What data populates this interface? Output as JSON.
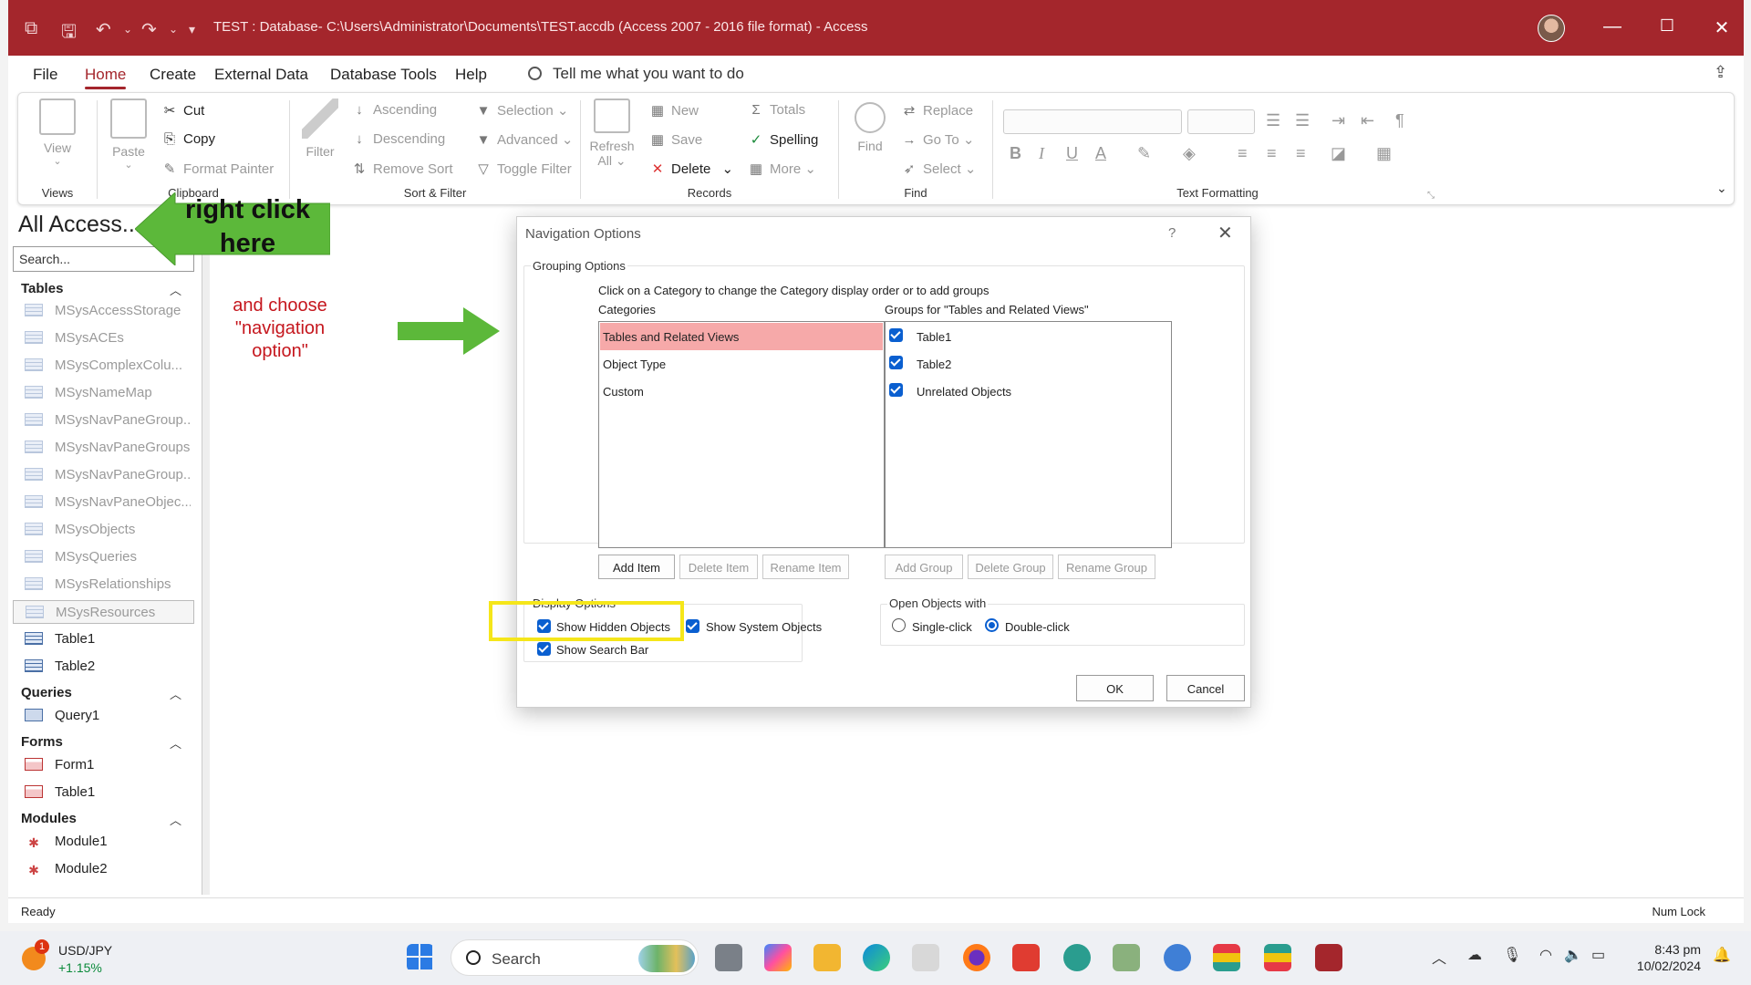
{
  "window": {
    "title": "TEST : Database- C:\\Users\\Administrator\\Documents\\TEST.accdb (Access 2007 - 2016 file format)  -  Access"
  },
  "menu": {
    "tabs": [
      "File",
      "Home",
      "Create",
      "External Data",
      "Database Tools",
      "Help"
    ],
    "active": "Home",
    "tell_me": "Tell me what you want to do"
  },
  "ribbon": {
    "views": {
      "view": "View",
      "label": "Views"
    },
    "clipboard": {
      "paste": "Paste",
      "cut": "Cut",
      "copy": "Copy",
      "format_painter": "Format Painter",
      "label": "Clipboard"
    },
    "sort_filter": {
      "filter": "Filter",
      "ascending": "Ascending",
      "descending": "Descending",
      "remove_sort": "Remove Sort",
      "selection": "Selection",
      "advanced": "Advanced",
      "toggle_filter": "Toggle Filter",
      "label": "Sort & Filter"
    },
    "records": {
      "refresh": "Refresh",
      "refresh_all": "All",
      "new": "New",
      "save": "Save",
      "delete": "Delete",
      "totals": "Totals",
      "spelling": "Spelling",
      "more": "More",
      "label": "Records"
    },
    "find": {
      "find": "Find",
      "replace": "Replace",
      "goto": "Go To",
      "select": "Select",
      "label": "Find"
    },
    "text_formatting": {
      "bold": "B",
      "italic": "I",
      "underline": "U",
      "font_color": "A",
      "label": "Text Formatting"
    }
  },
  "navpane": {
    "header": "All Access...",
    "search_placeholder": "Search...",
    "sections": [
      {
        "name": "Tables",
        "items": [
          "MSysAccessStorage",
          "MSysACEs",
          "MSysComplexColu...",
          "MSysNameMap",
          "MSysNavPaneGroup...",
          "MSysNavPaneGroups",
          "MSysNavPaneGroup...",
          "MSysNavPaneObjec...",
          "MSysObjects",
          "MSysQueries",
          "MSysRelationships",
          "MSysResources",
          "Table1",
          "Table2"
        ]
      },
      {
        "name": "Queries",
        "items": [
          "Query1"
        ]
      },
      {
        "name": "Forms",
        "items": [
          "Form1",
          "Table1"
        ]
      },
      {
        "name": "Modules",
        "items": [
          "Module1",
          "Module2"
        ]
      }
    ]
  },
  "annotations": {
    "right_click_line1": "right click",
    "right_click_line2": "here",
    "choose_line1": "and choose",
    "choose_line2": "\"navigation",
    "choose_line3": "option\"",
    "arrow_color": "#5cb83a",
    "highlight_color": "#f5e61a"
  },
  "dialog": {
    "title": "Navigation Options",
    "help": "?",
    "grouping_legend": "Grouping Options",
    "instruction": "Click on a Category to change the Category display order or to add groups",
    "categories_label": "Categories",
    "categories": [
      "Tables and Related Views",
      "Object Type",
      "Custom"
    ],
    "selected_category": "Tables and Related Views",
    "groups_label": "Groups for \"Tables and Related Views\"",
    "groups": [
      {
        "name": "Table1",
        "checked": true
      },
      {
        "name": "Table2",
        "checked": true
      },
      {
        "name": "Unrelated Objects",
        "checked": true
      }
    ],
    "buttons": {
      "add_item": "Add Item",
      "delete_item": "Delete Item",
      "rename_item": "Rename Item",
      "add_group": "Add Group",
      "delete_group": "Delete Group",
      "rename_group": "Rename Group",
      "ok": "OK",
      "cancel": "Cancel"
    },
    "display_legend": "Display Options",
    "show_hidden": "Show Hidden Objects",
    "show_system": "Show System Objects",
    "show_search": "Show Search Bar",
    "open_legend": "Open Objects with",
    "single_click": "Single-click",
    "double_click": "Double-click",
    "open_mode": "Double-click"
  },
  "status": {
    "left": "Ready",
    "right": "Num Lock"
  },
  "taskbar": {
    "ticker_symbol": "USD/JPY",
    "ticker_change": "+1.15%",
    "ticker_badge": "1",
    "search": "Search",
    "time": "8:43 pm",
    "date": "10/02/2024"
  }
}
